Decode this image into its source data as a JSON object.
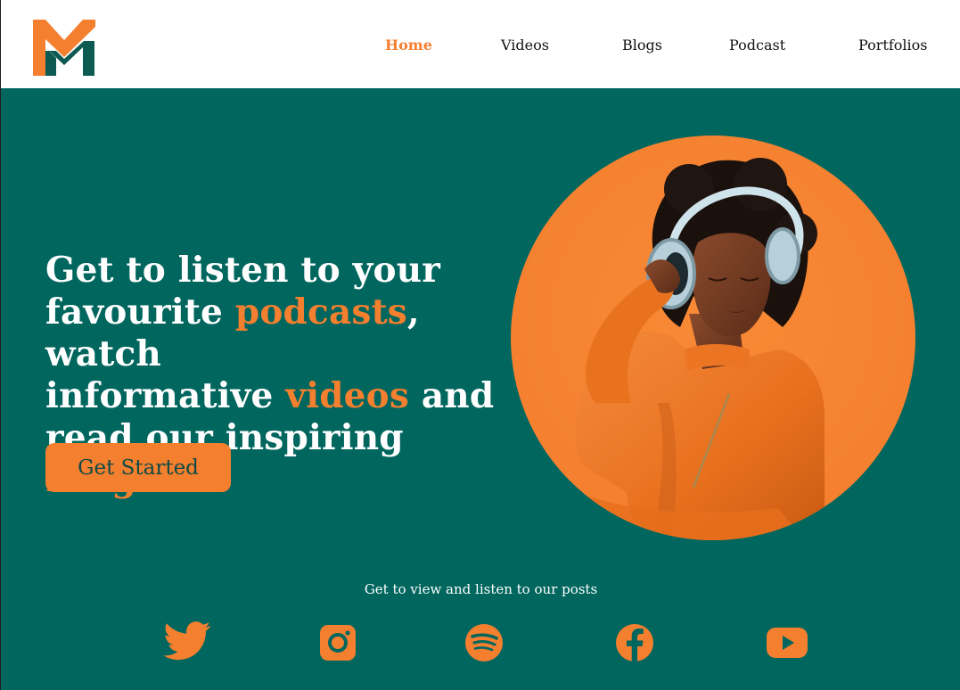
{
  "brand": {
    "logo_alt": "M",
    "colors": {
      "primary": "#00665e",
      "accent": "#f47f2f",
      "dark_green": "#0d5a52"
    }
  },
  "nav": {
    "items": [
      {
        "label": "Home",
        "active": true
      },
      {
        "label": "Videos",
        "active": false
      },
      {
        "label": "Blogs",
        "active": false
      },
      {
        "label": "Podcast",
        "active": false
      },
      {
        "label": "Portfolios",
        "active": false
      }
    ]
  },
  "hero": {
    "line1": "Get to listen to your",
    "line2_pre": "favourite ",
    "line2_highlight": "podcasts",
    "line2_post": ", watch",
    "line3_pre": "informative ",
    "line3_highlight": "videos",
    "line3_post": " and",
    "line4_pre": "read our inspiring ",
    "line4_highlight": "Blogs",
    "cta_label": "Get Started",
    "image_icon": "woman-with-headphones-image"
  },
  "footer": {
    "tagline": "Get to view and listen to our posts",
    "social": [
      {
        "icon": "twitter-icon"
      },
      {
        "icon": "instagram-icon"
      },
      {
        "icon": "spotify-icon"
      },
      {
        "icon": "facebook-icon"
      },
      {
        "icon": "youtube-icon"
      }
    ]
  }
}
